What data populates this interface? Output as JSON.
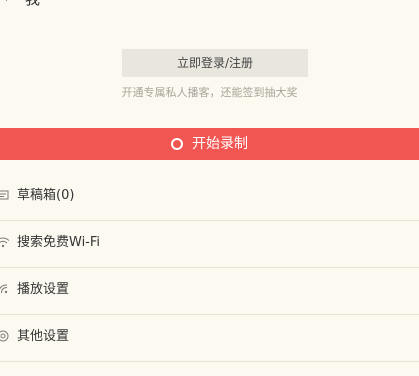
{
  "header": {
    "title": "我"
  },
  "account": {
    "login_label": "立即登录/注册",
    "hint": "开通专属私人播客，还能签到抽大奖"
  },
  "record": {
    "label": "开始录制",
    "color": "#f25652"
  },
  "menu": {
    "items": [
      {
        "label": "草稿箱(0)",
        "icon": "drafts-icon"
      },
      {
        "label": "搜索免费Wi-Fi",
        "icon": "wifi-icon"
      },
      {
        "label": "播放设置",
        "icon": "play-settings-icon"
      },
      {
        "label": "其他设置",
        "icon": "other-settings-icon"
      }
    ]
  }
}
